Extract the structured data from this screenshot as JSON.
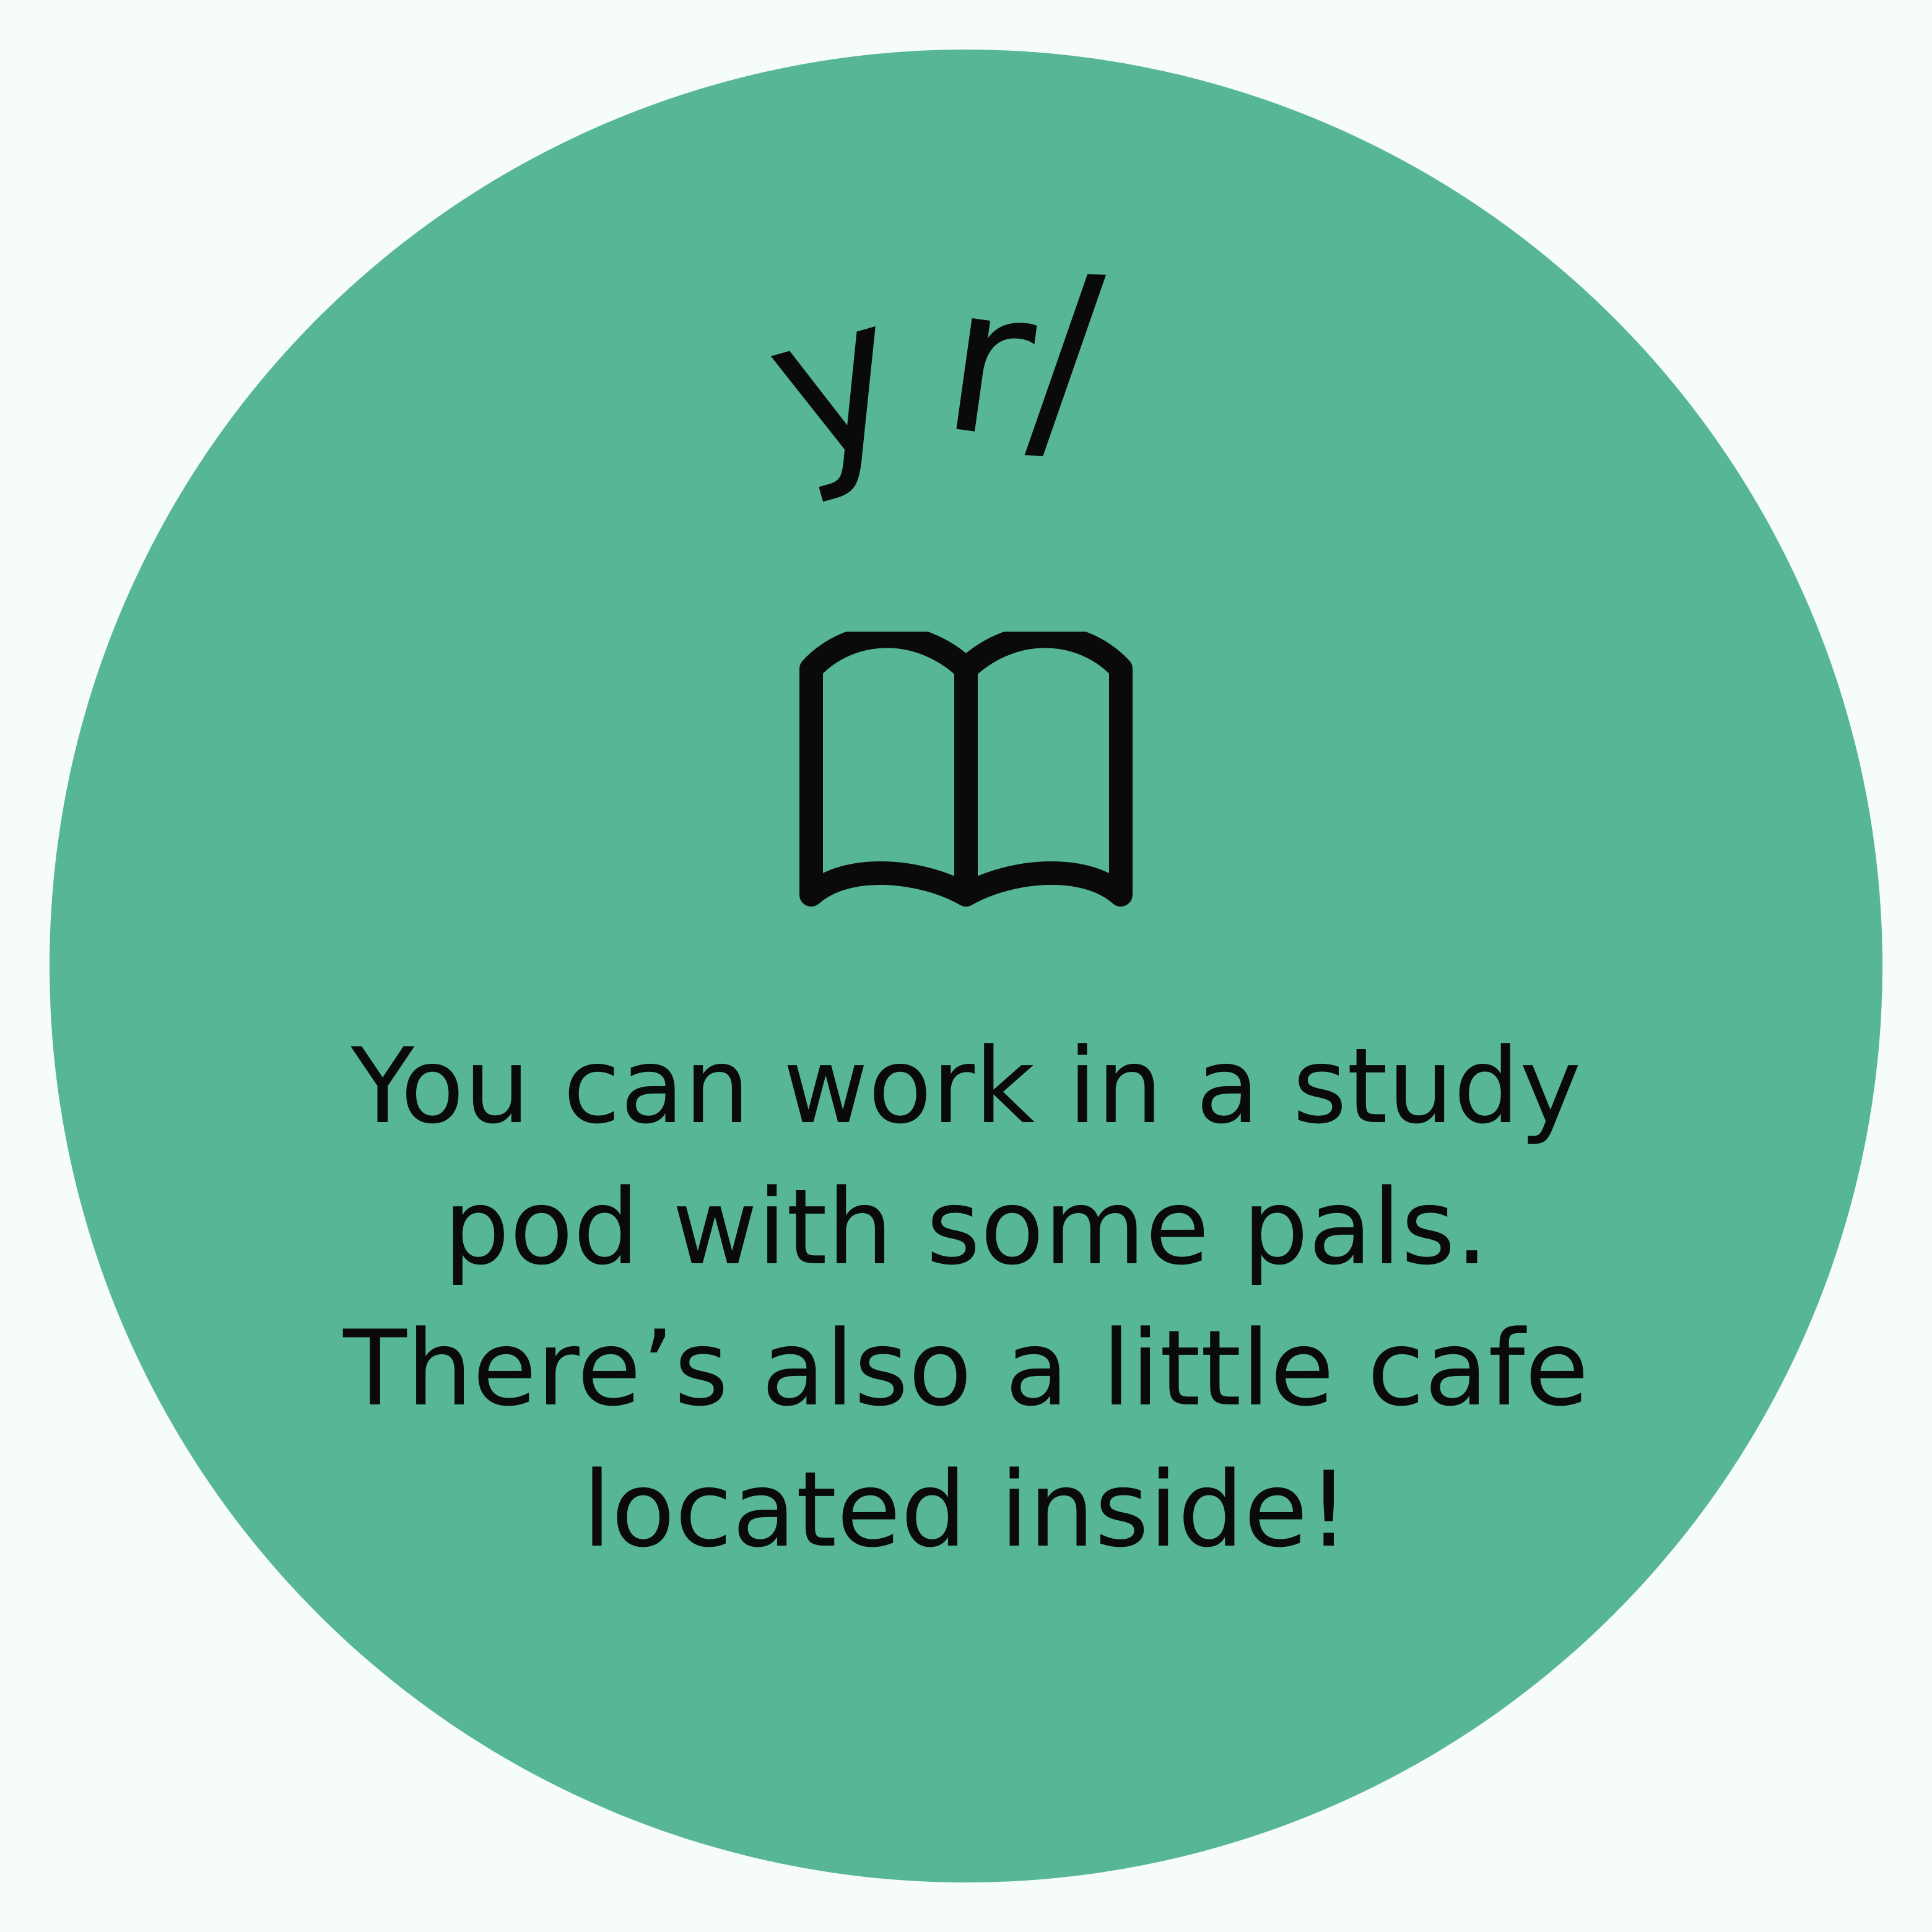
{
  "badge": {
    "background_color": "#57b794",
    "page_background_color": "#f6fcfc",
    "ink_color": "#0a0a0a"
  },
  "logo": {
    "letters": [
      "y",
      "r",
      "/"
    ]
  },
  "icon": {
    "name": "open-book-icon"
  },
  "message": {
    "lines": [
      "You can work in a study",
      "pod with some pals.",
      "There’s also a little cafe",
      "located inside!"
    ]
  }
}
